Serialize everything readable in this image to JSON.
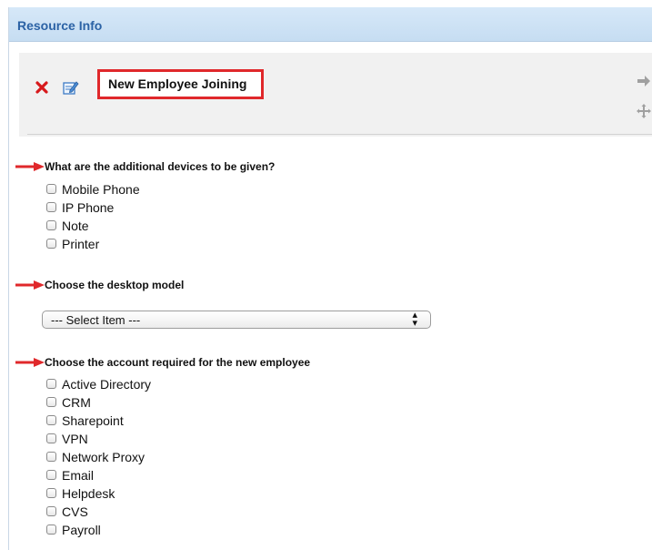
{
  "panel": {
    "title": "Resource Info",
    "header_color": "#2b62a5"
  },
  "card": {
    "title": "New Employee Joining",
    "highlight_color": "#e0282b",
    "icons": [
      "delete-icon",
      "edit-icon",
      "arrow-right-icon",
      "move-icon"
    ]
  },
  "questions": [
    {
      "label": "What are the additional devices to be given?",
      "type": "checkbox",
      "options": [
        "Mobile Phone",
        "IP Phone",
        "Note",
        "Printer"
      ]
    },
    {
      "label": "Choose the desktop model",
      "type": "select",
      "selected": "--- Select Item ---"
    },
    {
      "label": "Choose the account required for the new employee",
      "type": "checkbox",
      "options": [
        "Active Directory",
        "CRM",
        "Sharepoint",
        "VPN",
        "Network Proxy",
        "Email",
        "Helpdesk",
        "CVS",
        "Payroll"
      ]
    }
  ],
  "annotation_color": "#e0282b"
}
